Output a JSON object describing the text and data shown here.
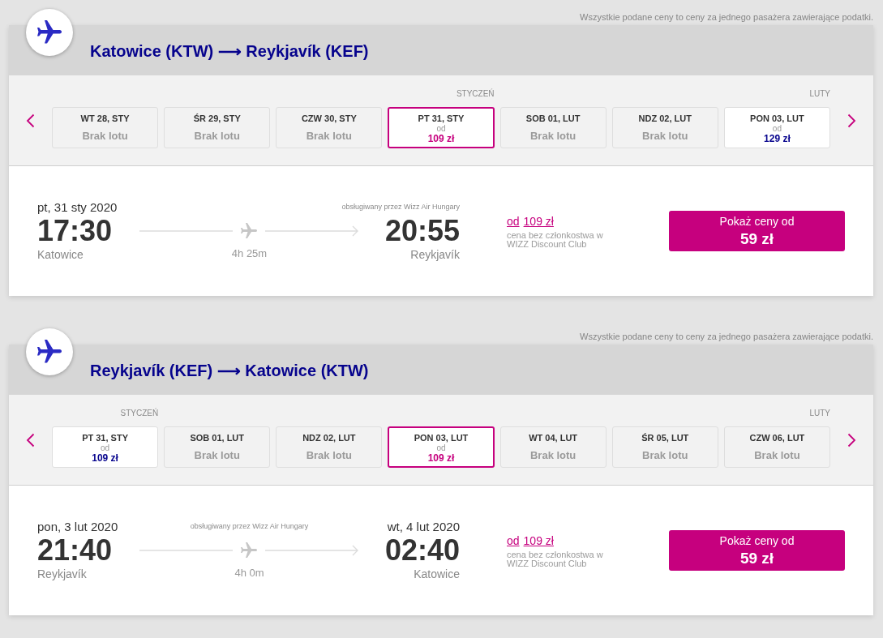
{
  "sections": [
    {
      "notice": "Wszystkie podane ceny to ceny za jednego pasażera zawierające podatki.",
      "title": "Katowice (KTW) ⟶ Reykjavík (KEF)",
      "days": [
        {
          "kind": "no_flight",
          "label": "WT 28, STY",
          "status": "Brak lotu",
          "selected": false
        },
        {
          "kind": "no_flight",
          "label": "ŚR 29, STY",
          "status": "Brak lotu",
          "selected": false
        },
        {
          "kind": "no_flight",
          "label": "CZW 30, STY",
          "status": "Brak lotu",
          "selected": false
        },
        {
          "kind": "fare",
          "month_label": "STYCZEŃ",
          "label": "PT 31, STY",
          "prefix": "od",
          "price": "109 zł",
          "selected": true
        },
        {
          "kind": "no_flight",
          "label": "SOB 01, LUT",
          "status": "Brak lotu",
          "selected": false
        },
        {
          "kind": "no_flight",
          "label": "NDZ 02, LUT",
          "status": "Brak lotu",
          "selected": false
        },
        {
          "kind": "fare",
          "month_label": "LUTY",
          "label": "PON 03, LUT",
          "prefix": "od",
          "price": "129 zł",
          "selected": false
        }
      ],
      "flight": {
        "departure_date": "pt, 31 sty 2020",
        "operator": "obsługiwany przez Wizz Air Hungary",
        "departure_time": "17:30",
        "arrival_time": "20:55",
        "departure_city": "Katowice",
        "duration": "4h 25m",
        "arrival_city": "Reykjavík",
        "fare_prefix": "od",
        "fare": "109 zł",
        "fare_note": "cena bez członkostwa w WIZZ Discount Club",
        "cta_label": "Pokaż ceny od",
        "cta_price": "59 zł"
      }
    },
    {
      "notice": "Wszystkie podane ceny to ceny za jednego pasażera zawierające podatki.",
      "title": "Reykjavík (KEF) ⟶ Katowice (KTW)",
      "days": [
        {
          "kind": "fare",
          "month_label": "STYCZEŃ",
          "label": "PT 31, STY",
          "prefix": "od",
          "price": "109 zł",
          "selected": false
        },
        {
          "kind": "no_flight",
          "label": "SOB 01, LUT",
          "status": "Brak lotu",
          "selected": false
        },
        {
          "kind": "no_flight",
          "label": "NDZ 02, LUT",
          "status": "Brak lotu",
          "selected": false
        },
        {
          "kind": "fare",
          "label": "PON 03, LUT",
          "prefix": "od",
          "price": "109 zł",
          "selected": true
        },
        {
          "kind": "no_flight",
          "label": "WT 04, LUT",
          "status": "Brak lotu",
          "selected": false
        },
        {
          "kind": "no_flight",
          "label": "ŚR 05, LUT",
          "status": "Brak lotu",
          "selected": false
        },
        {
          "kind": "no_flight",
          "month_label": "LUTY",
          "label": "CZW 06, LUT",
          "status": "Brak lotu",
          "selected": false
        }
      ],
      "flight": {
        "departure_date": "pon, 3 lut 2020",
        "operator": "obsługiwany przez Wizz Air Hungary",
        "arrival_date": "wt, 4 lut 2020",
        "departure_time": "21:40",
        "arrival_time": "02:40",
        "departure_city": "Reykjavík",
        "duration": "4h 0m",
        "arrival_city": "Katowice",
        "fare_prefix": "od",
        "fare": "109 zł",
        "fare_note": "cena bez członkostwa w WIZZ Discount Club",
        "cta_label": "Pokaż ceny od",
        "cta_price": "59 zł"
      }
    }
  ]
}
